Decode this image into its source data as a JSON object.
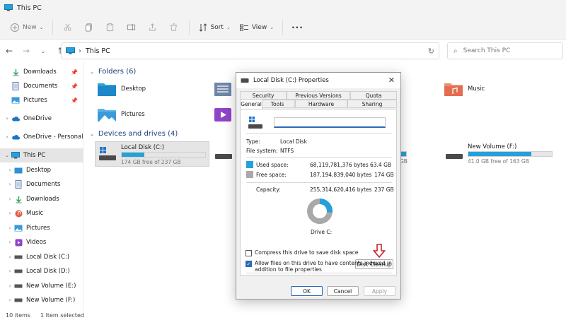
{
  "window": {
    "title": "This PC"
  },
  "toolbar": {
    "new_label": "New",
    "sort_label": "Sort",
    "view_label": "View",
    "more_label": "···"
  },
  "address": {
    "crumb": "This PC",
    "search_placeholder": "Search This PC"
  },
  "sidebar": {
    "items": [
      {
        "label": "Downloads"
      },
      {
        "label": "Documents"
      },
      {
        "label": "Pictures"
      },
      {
        "label": "OneDrive"
      },
      {
        "label": "OneDrive - Personal"
      },
      {
        "label": "This PC"
      },
      {
        "label": "Desktop"
      },
      {
        "label": "Documents"
      },
      {
        "label": "Downloads"
      },
      {
        "label": "Music"
      },
      {
        "label": "Pictures"
      },
      {
        "label": "Videos"
      },
      {
        "label": "Local Disk (C:)"
      },
      {
        "label": "Local Disk (D:)"
      },
      {
        "label": "New Volume (E:)"
      },
      {
        "label": "New Volume (F:)"
      }
    ]
  },
  "status": {
    "count": "10 items",
    "selected": "1 item selected"
  },
  "content": {
    "folders_header": "Folders (6)",
    "drives_header": "Devices and drives (4)",
    "folders": [
      {
        "name": "Desktop"
      },
      {
        "name": "Music"
      },
      {
        "name": "Pictures"
      }
    ],
    "drives": [
      {
        "name": "Local Disk (C:)",
        "free": "174 GB free of 237 GB",
        "used_fraction": 0.27
      },
      {
        "name": "New Volume (F:)",
        "free": "41.0 GB free of 163 GB",
        "used_fraction": 0.75
      }
    ],
    "partial_drive_text": "GB"
  },
  "dialog": {
    "title": "Local Disk (C:) Properties",
    "tabs_top": [
      "Security",
      "Previous Versions",
      "Quota"
    ],
    "tabs_bottom": [
      "General",
      "Tools",
      "Hardware",
      "Sharing"
    ],
    "name_value": "",
    "type_label": "Type:",
    "type_value": "Local Disk",
    "fs_label": "File system:",
    "fs_value": "NTFS",
    "used_label": "Used space:",
    "used_bytes": "68,119,781,376 bytes",
    "used_gb": "63.4 GB",
    "free_label": "Free space:",
    "free_bytes": "187,194,839,040 bytes",
    "free_gb": "174 GB",
    "cap_label": "Capacity:",
    "cap_bytes": "255,314,620,416 bytes",
    "cap_gb": "237 GB",
    "drive_label": "Drive C:",
    "cleanup_label": "Disk Cleanup",
    "compress_label": "Compress this drive to save disk space",
    "index_label": "Allow files on this drive to have contents indexed in addition to file properties",
    "ok_label": "OK",
    "cancel_label": "Cancel",
    "apply_label": "Apply",
    "used_fraction": 0.267,
    "colors": {
      "used": "#26a0da",
      "free": "#a9a9a9"
    }
  }
}
